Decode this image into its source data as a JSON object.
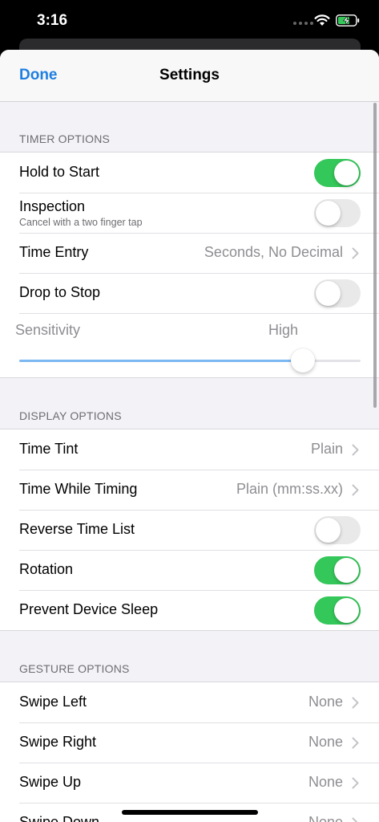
{
  "status_bar": {
    "time": "3:16"
  },
  "nav": {
    "done_label": "Done",
    "title": "Settings"
  },
  "timer_options": {
    "header": "TIMER OPTIONS",
    "hold_to_start": {
      "label": "Hold to Start",
      "enabled": true
    },
    "inspection": {
      "label": "Inspection",
      "sublabel": "Cancel with a two finger tap",
      "enabled": false
    },
    "time_entry": {
      "label": "Time Entry",
      "value": "Seconds, No Decimal"
    },
    "drop_to_stop": {
      "label": "Drop to Stop",
      "enabled": false
    },
    "sensitivity": {
      "label": "Sensitivity",
      "value_label": "High",
      "level": 0.83
    }
  },
  "display_options": {
    "header": "DISPLAY OPTIONS",
    "time_tint": {
      "label": "Time Tint",
      "value": "Plain"
    },
    "time_while_timing": {
      "label": "Time While Timing",
      "value": "Plain (mm:ss.xx)"
    },
    "reverse_time_list": {
      "label": "Reverse Time List",
      "enabled": false
    },
    "rotation": {
      "label": "Rotation",
      "enabled": true
    },
    "prevent_device_sleep": {
      "label": "Prevent Device Sleep",
      "enabled": true
    }
  },
  "gesture_options": {
    "header": "GESTURE OPTIONS",
    "swipe_left": {
      "label": "Swipe Left",
      "value": "None"
    },
    "swipe_right": {
      "label": "Swipe Right",
      "value": "None"
    },
    "swipe_up": {
      "label": "Swipe Up",
      "value": "None"
    },
    "swipe_down": {
      "label": "Swipe Down",
      "value": "None"
    }
  },
  "colors": {
    "accent": "#1f7fe0",
    "toggle_on": "#34c759",
    "toggle_off": "#e9e9ea",
    "slider_fill": "#7cb8f2"
  }
}
